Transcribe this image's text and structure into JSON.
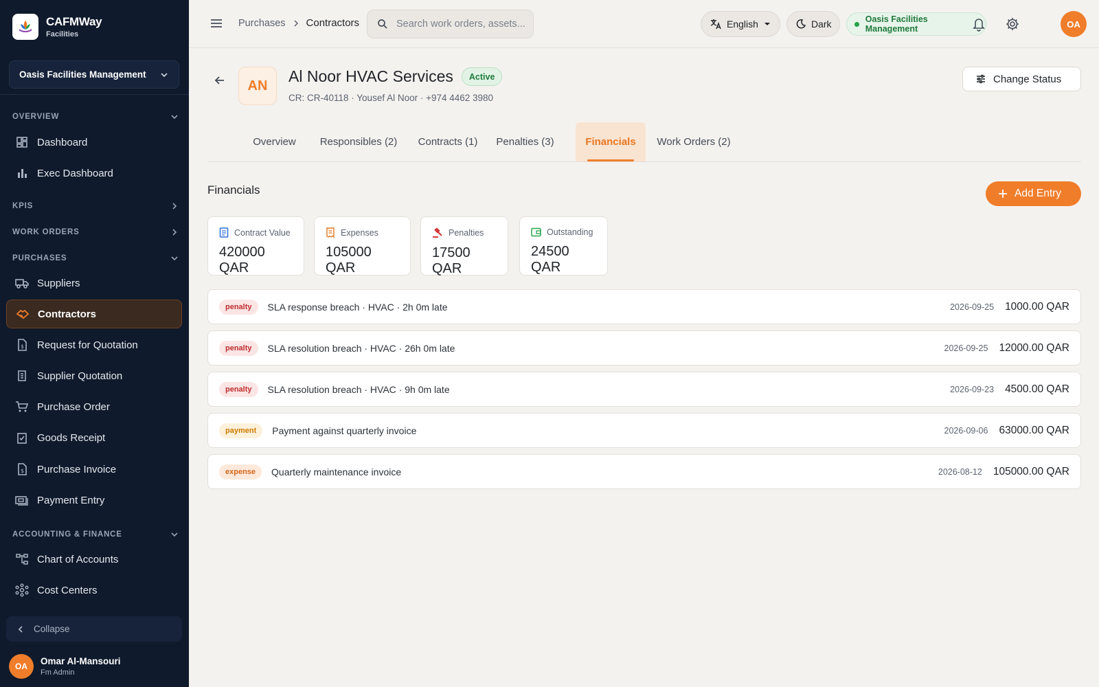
{
  "brand": {
    "name_main": "CAFM",
    "name_accent": "Way",
    "subtitle": "Facilities"
  },
  "org_selector": {
    "value": "Oasis Facilities Management"
  },
  "sidebar": {
    "sections": [
      {
        "label": "OVERVIEW"
      },
      {
        "label": "KPIS"
      },
      {
        "label": "WORK ORDERS"
      },
      {
        "label": "PURCHASES"
      },
      {
        "label": "ACCOUNTING & FINANCE"
      }
    ],
    "items": [
      {
        "label": "Dashboard",
        "icon": "dashboard-icon"
      },
      {
        "label": "Exec Dashboard",
        "icon": "bar-chart-icon"
      },
      {
        "label": "Suppliers",
        "icon": "truck-icon"
      },
      {
        "label": "Contractors",
        "icon": "handshake-icon"
      },
      {
        "label": "Request for Quotation",
        "icon": "document-dollar-icon"
      },
      {
        "label": "Supplier Quotation",
        "icon": "receipt-icon"
      },
      {
        "label": "Purchase Order",
        "icon": "cart-icon"
      },
      {
        "label": "Goods Receipt",
        "icon": "clipboard-check-icon"
      },
      {
        "label": "Purchase Invoice",
        "icon": "invoice-icon"
      },
      {
        "label": "Payment Entry",
        "icon": "payment-icon"
      },
      {
        "label": "Chart of Accounts",
        "icon": "account-tree-icon"
      },
      {
        "label": "Cost Centers",
        "icon": "hub-icon"
      }
    ],
    "collapse_label": "Collapse"
  },
  "user": {
    "initials": "OA",
    "name": "Omar Al-Mansouri",
    "role": "Fm Admin"
  },
  "topbar": {
    "breadcrumb": {
      "parent": "Purchases",
      "current": "Contractors"
    },
    "search_placeholder": "Search work orders, assets...",
    "language": "English",
    "theme": "Dark",
    "org_badge": "Oasis Facilities Management",
    "avatar_initials": "OA"
  },
  "contractor": {
    "initials": "AN",
    "name": "Al Noor HVAC Services",
    "status": "Active",
    "subtitle": "CR: CR-40118 · Yousef Al Noor · +974 4462 3980",
    "change_status_label": "Change Status"
  },
  "tabs": [
    {
      "label": "Overview"
    },
    {
      "label": "Responsibles (2)"
    },
    {
      "label": "Contracts (1)"
    },
    {
      "label": "Penalties (3)"
    },
    {
      "label": "Financials",
      "active": true
    },
    {
      "label": "Work Orders (2)"
    }
  ],
  "financials": {
    "title": "Financials",
    "add_label": "Add Entry",
    "stats": [
      {
        "label": "Contract Value",
        "value": "420000 QAR",
        "icon": "contract-icon",
        "color": "#2f6fd6"
      },
      {
        "label": "Expenses",
        "value": "105000 QAR",
        "icon": "receipt-icon",
        "color": "#e8761f"
      },
      {
        "label": "Penalties",
        "value": "17500 QAR",
        "icon": "gavel-icon",
        "color": "#d23a3a"
      },
      {
        "label": "Outstanding",
        "value": "24500 QAR",
        "icon": "wallet-icon",
        "color": "#26a34a"
      }
    ],
    "entries": [
      {
        "type": "penalty",
        "description": "SLA response breach · HVAC · 2h 0m late",
        "date": "2026-09-25",
        "amount": "1000.00 QAR"
      },
      {
        "type": "penalty",
        "description": "SLA resolution breach · HVAC · 26h 0m late",
        "date": "2026-09-25",
        "amount": "12000.00 QAR"
      },
      {
        "type": "penalty",
        "description": "SLA resolution breach · HVAC · 9h 0m late",
        "date": "2026-09-23",
        "amount": "4500.00 QAR"
      },
      {
        "type": "payment",
        "description": "Payment against quarterly invoice",
        "date": "2026-09-06",
        "amount": "63000.00 QAR"
      },
      {
        "type": "expense",
        "description": "Quarterly maintenance invoice",
        "date": "2026-08-12",
        "amount": "105000.00 QAR"
      }
    ]
  },
  "colors": {
    "accent": "#f07d2a",
    "sidebar_bg": "#0f1a2c",
    "active_green": "#26a34a"
  }
}
